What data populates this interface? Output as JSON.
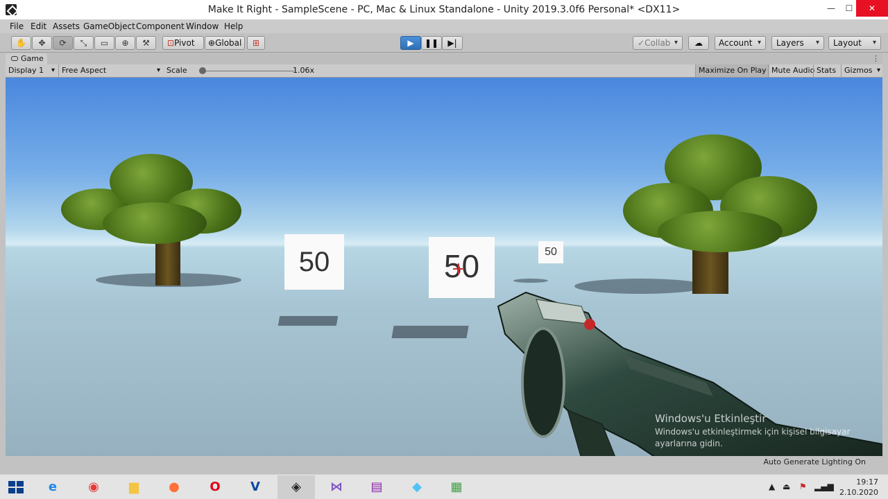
{
  "window": {
    "title": "Make It Right - SampleScene - PC, Mac & Linux Standalone - Unity 2019.3.0f6 Personal* <DX11>",
    "minimize_glyph": "—",
    "maximize_glyph": "☐",
    "close_glyph": "✕"
  },
  "menu": [
    "File",
    "Edit",
    "Assets",
    "GameObject",
    "Component",
    "Window",
    "Help"
  ],
  "toolbar": {
    "tools": [
      {
        "icon": "hand-icon",
        "glyph": "✋"
      },
      {
        "icon": "move-icon",
        "glyph": "✥"
      },
      {
        "icon": "rotate-icon",
        "glyph": "⟳"
      },
      {
        "icon": "scale-icon",
        "glyph": "⤡"
      },
      {
        "icon": "rect-icon",
        "glyph": "▭"
      },
      {
        "icon": "transform-icon",
        "glyph": "⊕"
      },
      {
        "icon": "custom-tool-icon",
        "glyph": "⚒"
      }
    ],
    "pivot_label": "Pivot",
    "global_label": "Global",
    "collab_label": "Collab",
    "account_label": "Account",
    "layers_label": "Layers",
    "layout_label": "Layout"
  },
  "game_tab": {
    "label": "Game",
    "menu_glyph": "⋮"
  },
  "game_toolbar": {
    "display": "Display 1",
    "aspect": "Free Aspect",
    "scale_label": "Scale",
    "scale_value": "1.06x",
    "scale_fraction": 0.01,
    "maximize_on_play": "Maximize On Play",
    "mute_audio": "Mute Audio",
    "stats": "Stats",
    "gizmos": "Gizmos"
  },
  "scene": {
    "targets": [
      "50",
      "50",
      "50"
    ]
  },
  "watermark": {
    "title": "Windows'u Etkinleştir",
    "line1": "Windows'u etkinleştirmek için kişisel bilgisayar",
    "line2": "ayarlarına gidin."
  },
  "statusbar": {
    "text": "Auto Generate Lighting On"
  },
  "taskbar": {
    "apps": [
      {
        "name": "internet-explorer-icon",
        "glyph": "e",
        "color": "#1e88e5"
      },
      {
        "name": "chrome-icon",
        "glyph": "◉",
        "color": "#e53935"
      },
      {
        "name": "file-explorer-icon",
        "glyph": "▆",
        "color": "#f4c542"
      },
      {
        "name": "firefox-icon",
        "glyph": "●",
        "color": "#ff7139"
      },
      {
        "name": "opera-icon",
        "glyph": "O",
        "color": "#e0001b"
      },
      {
        "name": "vegas-icon",
        "glyph": "V",
        "color": "#0d47a1"
      },
      {
        "name": "unity-icon",
        "glyph": "◈",
        "color": "#222222"
      },
      {
        "name": "visual-studio-icon",
        "glyph": "⋈",
        "color": "#7e57c2"
      },
      {
        "name": "winrar-icon",
        "glyph": "▤",
        "color": "#8e24aa"
      },
      {
        "name": "notes-icon",
        "glyph": "◆",
        "color": "#4fc3f7"
      },
      {
        "name": "task-manager-icon",
        "glyph": "▦",
        "color": "#43a047"
      }
    ],
    "time": "19:17",
    "date": "2.10.2020"
  }
}
